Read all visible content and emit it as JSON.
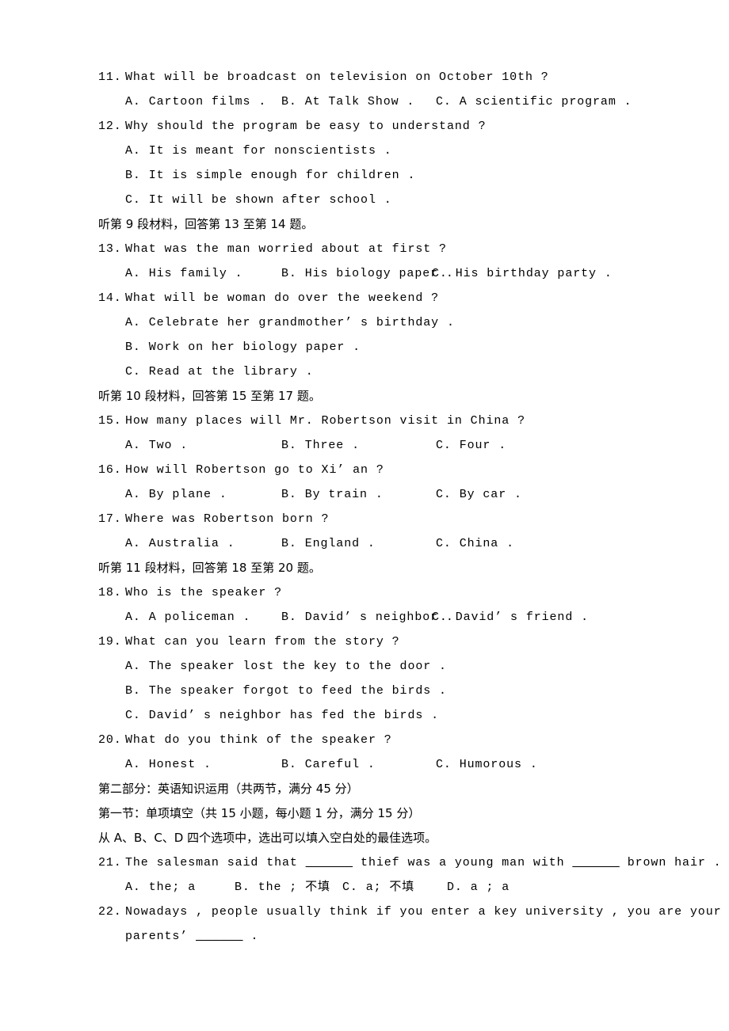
{
  "document": {
    "type": "exam-paper",
    "language": "en-zh",
    "background_color": "#ffffff",
    "text_color": "#000000"
  },
  "questions": [
    {
      "number": "11.",
      "stem": "What will be broadcast on television on October 10th ?",
      "options_inline": [
        "A. Cartoon films .",
        "B. At Talk Show .",
        "C. A scientific program ."
      ]
    },
    {
      "number": "12.",
      "stem": "Why should the program be easy to understand ?",
      "options_stacked": [
        "A. It is meant for nonscientists .",
        "B. It is simple enough for children .",
        "C. It will be shown after school ."
      ]
    },
    {
      "number": "13.",
      "stem": "What was the man worried about at first ?",
      "options_inline": [
        "A. His family .",
        "B. His biology paper .",
        "C. His birthday party ."
      ]
    },
    {
      "number": "14.",
      "stem": "What will be woman do over the weekend ?",
      "options_stacked": [
        "A. Celebrate her grandmother’ s birthday .",
        "B. Work on her biology paper .",
        "C. Read at the library ."
      ]
    },
    {
      "number": "15.",
      "stem": "How many places will Mr. Robertson visit in China ?",
      "options_inline": [
        "A. Two .",
        "B. Three .",
        "C. Four ."
      ]
    },
    {
      "number": "16.",
      "stem": "How will Robertson go to Xi’ an ?",
      "options_inline": [
        "A. By plane .",
        "B. By train .",
        "C. By car ."
      ]
    },
    {
      "number": "17.",
      "stem": "Where was Robertson born ?",
      "options_inline": [
        "A. Australia .",
        "B. England .",
        "C. China ."
      ]
    },
    {
      "number": "18.",
      "stem": "Who is the speaker ?",
      "options_inline": [
        "A. A policeman .",
        "B. David’ s neighbor .",
        "C. David’ s friend ."
      ]
    },
    {
      "number": "19.",
      "stem": "What can you learn from the story ?",
      "options_stacked": [
        "A. The speaker lost the key to the door .",
        "B. The speaker forgot to feed the birds .",
        "C. David’ s neighbor has fed the birds ."
      ]
    },
    {
      "number": "20.",
      "stem": "What do you think of the speaker ?",
      "options_inline": [
        "A. Honest .",
        "B. Careful .",
        "C. Humorous ."
      ]
    },
    {
      "number": "21.",
      "stem_part1": "The salesman said that ",
      "blank1": "______",
      "stem_part2": " thief was a young man with ",
      "blank2": "______",
      "stem_part3": " brown hair .",
      "options_inline4": [
        "A. the; a",
        "B. the ; 不填",
        "C. a; 不填",
        "D. a ; a"
      ]
    },
    {
      "number": "22.",
      "stem_line1": "Nowadays , people usually think if you enter a key university , you are your",
      "stem_line2_pre": "parents’ ",
      "stem_line2_blank": "______",
      "stem_line2_post": " ."
    }
  ],
  "listening_directions": [
    "听第 9 段材料，回答第 13 至第 14 题。",
    "听第 10 段材料，回答第 15 至第 17 题。",
    "听第 11 段材料，回答第 18 至第 20 题。"
  ],
  "section_headers": {
    "part_two": "第二部分：英语知识运用（共两节，满分 45 分）",
    "section_one": "第一节：单项填空（共 15 小题，每小题 1 分，满分 15 分）",
    "instruction": "从 A、B、C、D 四个选项中，选出可以填入空白处的最佳选项。"
  }
}
